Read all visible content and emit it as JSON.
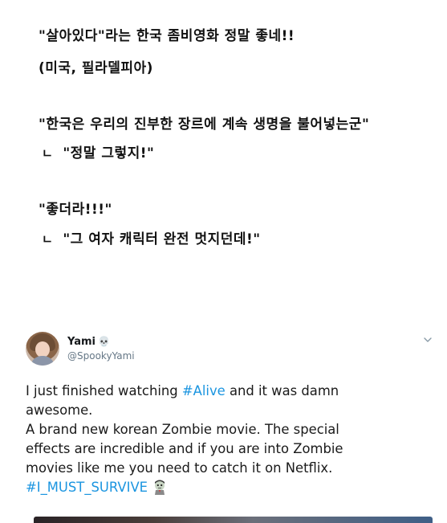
{
  "korean_comments": [
    {
      "text": "\"살아있다\"라는 한국 좀비영화 정말 좋네!!",
      "reply": false
    },
    {
      "text": "(미국, 필라델피아)",
      "reply": false
    },
    {
      "text": "\"한국은 우리의 진부한 장르에 계속 생명을 불어넣는군\"",
      "reply": false
    },
    {
      "text": "\"정말 그렇지!\"",
      "reply": true,
      "marker": "ㄴ"
    },
    {
      "text": "\"좋더라!!!\"",
      "reply": false
    },
    {
      "text": "\"그 여자 캐릭터 완전 멋지던데!\"",
      "reply": true,
      "marker": "ㄴ"
    }
  ],
  "tweet": {
    "user_name": "Yami",
    "name_emoji": "💀",
    "handle": "@SpookyYami",
    "text": {
      "p1": "I just finished watching ",
      "hashtag1": "#Alive",
      "p2": " and it was damn",
      "line2": "awesome.",
      "line3": "A brand new korean Zombie movie. The special",
      "line4": "effects are incredible and if you are into Zombie",
      "line5": "movies like me you need to catch it on Netflix.",
      "hashtag2": "#I_MUST_SURVIVE"
    },
    "hashtag_color": "#1b95e0",
    "icons": {
      "menu": "chevron-down-icon",
      "emoji": "zombie-emoji-icon"
    }
  }
}
